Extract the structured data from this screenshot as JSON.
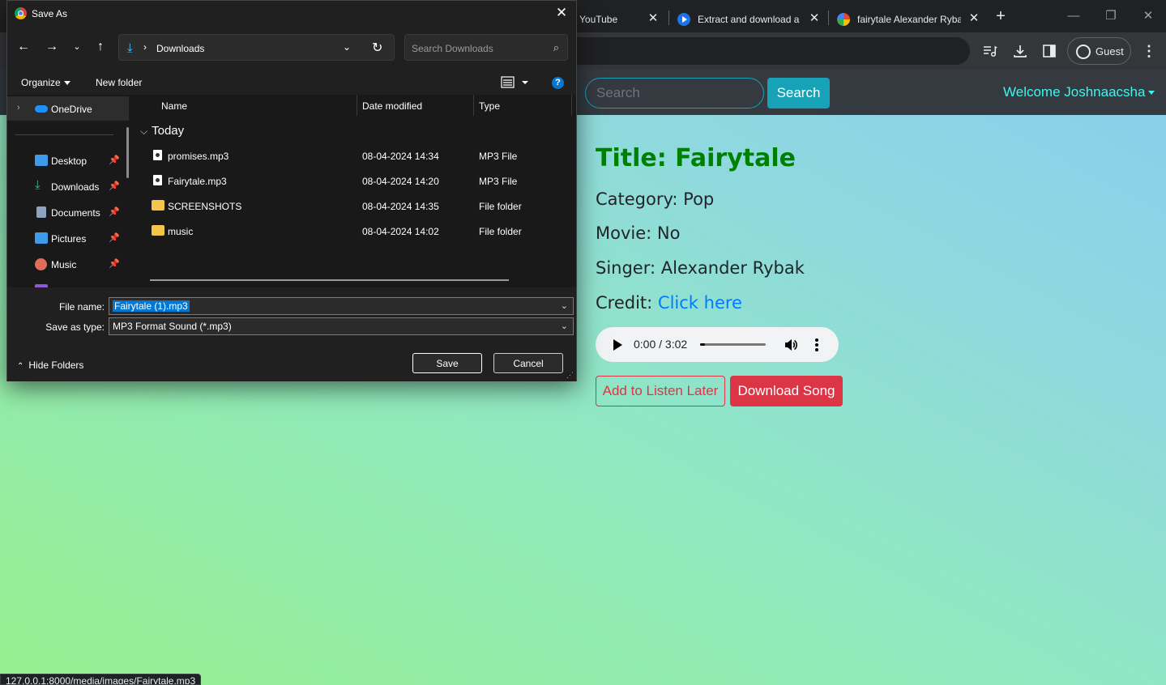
{
  "browser": {
    "tabs": [
      {
        "title": "YouTube",
        "active": false
      },
      {
        "title": "Extract and download a",
        "active": false
      },
      {
        "title": "fairytale Alexander Rybak",
        "active": true
      }
    ],
    "guest_label": "Guest",
    "status_url": "127.0.0.1:8000/media/images/Fairytale.mp3"
  },
  "site": {
    "search_placeholder": "Search",
    "search_button": "Search",
    "welcome": "Welcome Joshnaacsha",
    "song": {
      "title": "Title: Fairytale",
      "category": "Category: Pop",
      "movie": "Movie: No",
      "singer": "Singer: Alexander Rybak",
      "credit_label": "Credit:",
      "credit_link": "Click here"
    },
    "player": {
      "time": "0:00 / 3:02",
      "progress": 0.0
    },
    "buttons": {
      "listen_later": "Add to Listen Later",
      "download": "Download Song"
    }
  },
  "dialog": {
    "title": "Save As",
    "address": {
      "folder": "Downloads"
    },
    "search_placeholder": "Search Downloads",
    "toolbar": {
      "organize": "Organize",
      "new_folder": "New folder"
    },
    "nav": [
      {
        "label": "OneDrive",
        "icon": "onedrive-icon",
        "color": "#1e90ff",
        "pinned": false
      },
      {
        "label": "Desktop",
        "icon": "desktop-icon",
        "color": "#3d9be9",
        "pinned": true
      },
      {
        "label": "Downloads",
        "icon": "downloads-icon",
        "color": "#3fbf7f",
        "pinned": true
      },
      {
        "label": "Documents",
        "icon": "documents-icon",
        "color": "#8fa3bf",
        "pinned": true
      },
      {
        "label": "Pictures",
        "icon": "pictures-icon",
        "color": "#3d9be9",
        "pinned": true
      },
      {
        "label": "Music",
        "icon": "music-icon",
        "color": "#e06c5b",
        "pinned": true
      }
    ],
    "columns": {
      "name": "Name",
      "date": "Date modified",
      "type": "Type"
    },
    "group": "Today",
    "files": [
      {
        "name": "promises.mp3",
        "date": "08-04-2024 14:34",
        "type": "MP3 File",
        "kind": "file"
      },
      {
        "name": "Fairytale.mp3",
        "date": "08-04-2024 14:20",
        "type": "MP3 File",
        "kind": "file"
      },
      {
        "name": "SCREENSHOTS",
        "date": "08-04-2024 14:35",
        "type": "File folder",
        "kind": "folder"
      },
      {
        "name": "music",
        "date": "08-04-2024 14:02",
        "type": "File folder",
        "kind": "folder"
      }
    ],
    "file_name_label": "File name:",
    "file_name_value": "Fairytale (1).mp3",
    "save_type_label": "Save as type:",
    "save_type_value": "MP3 Format Sound (*.mp3)",
    "hide_folders": "Hide Folders",
    "save": "Save",
    "cancel": "Cancel"
  },
  "colors": {
    "accent": "#17a2b8",
    "danger": "#dc3545",
    "title_green": "#008000",
    "link": "#007bff",
    "welcome": "#3ff4f0"
  }
}
